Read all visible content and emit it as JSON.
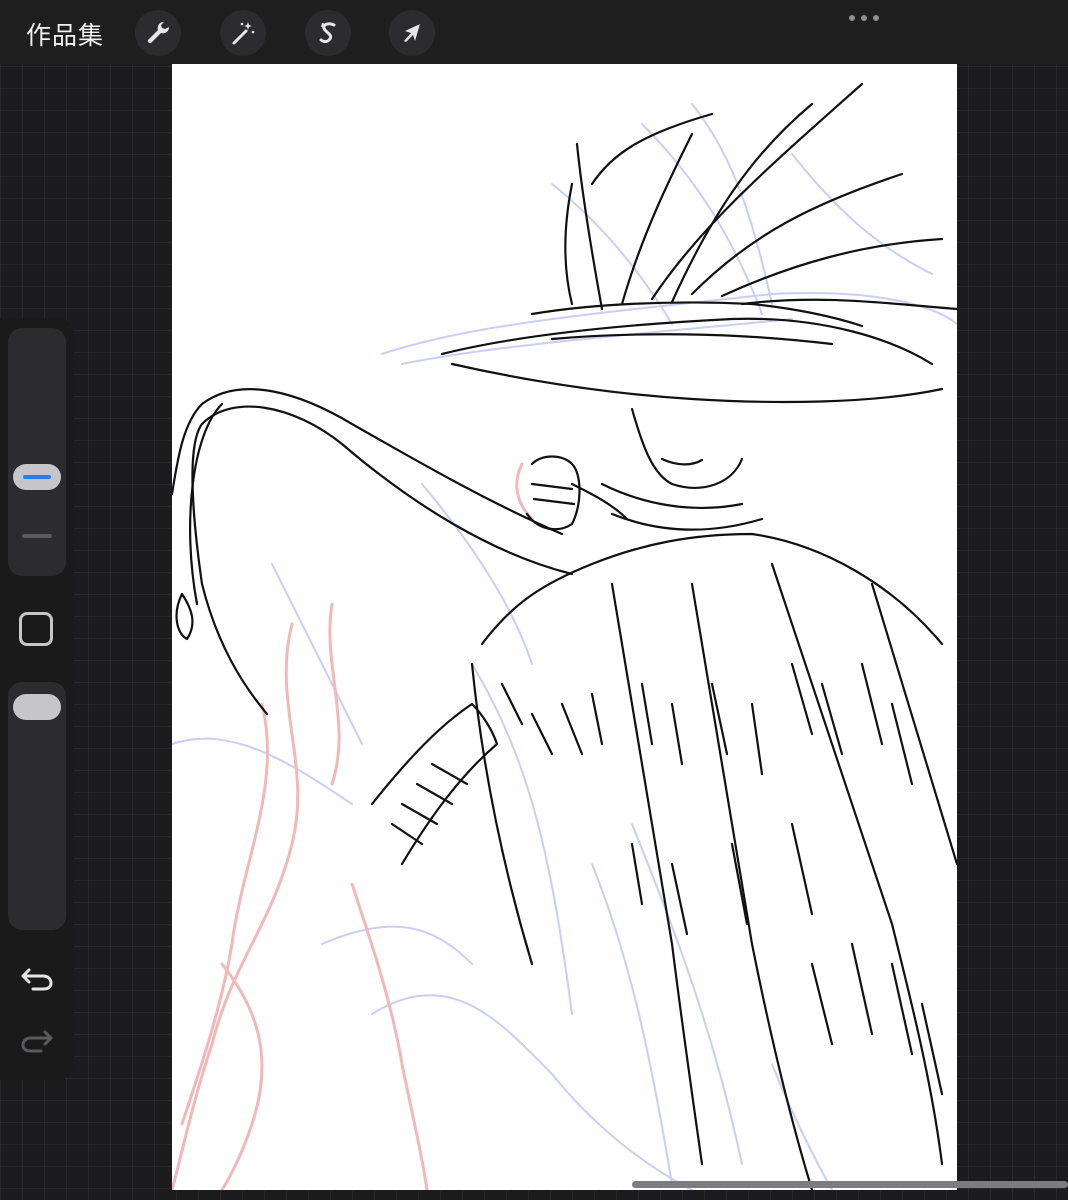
{
  "topbar": {
    "gallery_label": "作品集",
    "tools": [
      {
        "name": "actions",
        "icon": "wrench-icon"
      },
      {
        "name": "adjustments",
        "icon": "magic-wand-icon"
      },
      {
        "name": "selection",
        "icon": "selection-s-icon"
      },
      {
        "name": "transform",
        "icon": "arrow-cursor-icon"
      }
    ],
    "more_icon": "ellipsis-icon"
  },
  "sidebar": {
    "brush_size_icon": "blue-line-icon",
    "opacity_icon": "pill-icon",
    "modify_icon": "square-icon",
    "undo_icon": "undo-arrow-icon",
    "redo_icon": "redo-arrow-icon"
  },
  "canvas": {
    "artwork": "sketch-illustration",
    "ink_color": "#111111",
    "sketch_color": "#c9cef5",
    "accent_sketch_color": "#f2b8b8"
  },
  "colors": {
    "background": "#1c1c1e",
    "toolbar": "#1e1e1e",
    "accent": "#2b7bf4"
  }
}
